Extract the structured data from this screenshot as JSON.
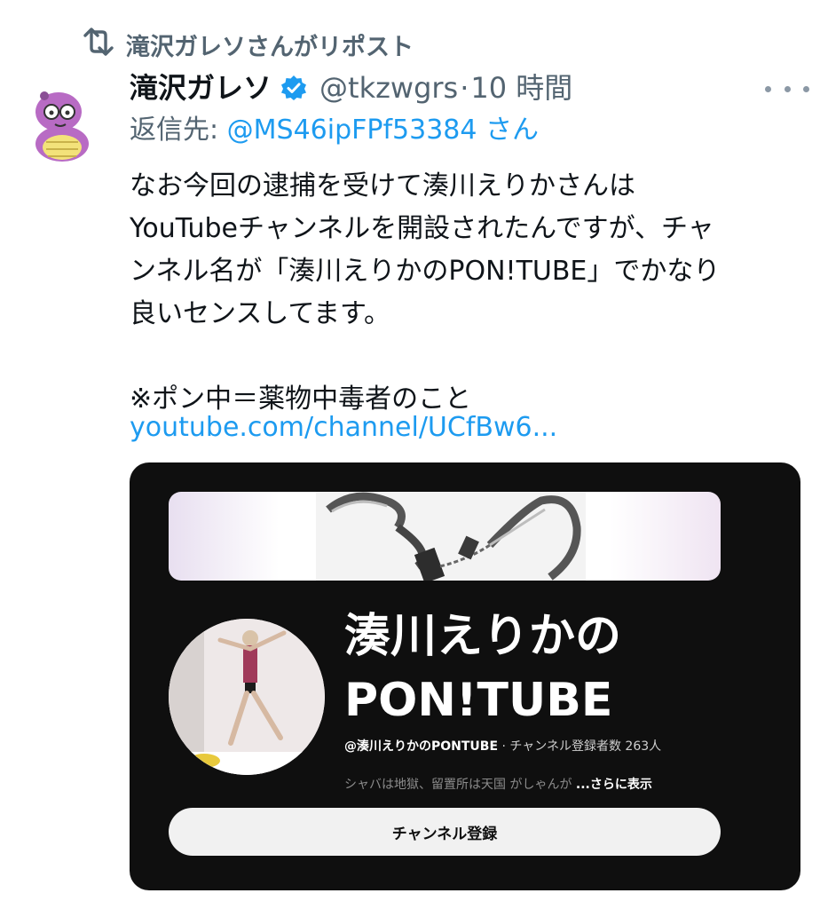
{
  "repost": {
    "text": "滝沢ガレソさんがリポスト",
    "icon": "repost-icon"
  },
  "tweet": {
    "display_name": "滝沢ガレソ",
    "verified_icon": "verified-badge-icon",
    "handle": "@tkzwgrs",
    "separator": "·",
    "time": "10 時間",
    "more_icon": "more-options-icon",
    "reply_label": "返信先:",
    "reply_to": "@MS46ipFPf53384 さん",
    "body": "なお今回の逮捕を受けて湊川えりかさんは\nYouTubeチャンネルを開設されたんですが、チャ\nンネル名が「湊川えりかのPON!TUBE」でかなり\n良いセンスしてます。\n\n※ポン中＝薬物中毒者のこと",
    "link": "youtube.com/channel/UCfBw6..."
  },
  "card": {
    "channel_name": "湊川えりかの\nPON!TUBE",
    "channel_handle": "@湊川えりかのPONTUBE",
    "meta_separator": " · ",
    "subscribers": "チャンネル登録者数 263人",
    "description": "シャバは地獄、留置所は天国 がしゃんが",
    "more_label": "...さらに表示",
    "subscribe_label": "チャンネル登録"
  },
  "colors": {
    "link": "#1d9bf0",
    "secondary_text": "#536471",
    "card_background": "#0f0f0f",
    "verified": "#1d9bf0"
  }
}
